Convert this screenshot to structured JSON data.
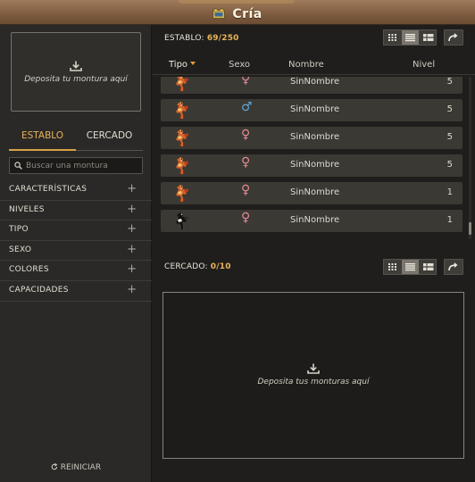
{
  "window": {
    "title": "Cría"
  },
  "left": {
    "dropzone_text": "Deposita tu montura aquí",
    "tabs": [
      "ESTABLO",
      "CERCADO"
    ],
    "search_placeholder": "Buscar una montura",
    "filters": [
      "CARACTERÍSTICAS",
      "NIVELES",
      "TIPO",
      "SEXO",
      "COLORES",
      "CAPACIDADES"
    ],
    "reset_label": "REINICIAR"
  },
  "stable": {
    "label": "ESTABLO:",
    "count": "69/250",
    "columns": [
      "Tipo",
      "Sexo",
      "Nombre",
      "Nivel"
    ],
    "rows": [
      {
        "type": "dragopavo-rojo",
        "sex": "female",
        "name": "SinNombre",
        "level": "5"
      },
      {
        "type": "dragopavo-rojo",
        "sex": "male",
        "name": "SinNombre",
        "level": "5"
      },
      {
        "type": "dragopavo-rojo",
        "sex": "female",
        "name": "SinNombre",
        "level": "5"
      },
      {
        "type": "dragopavo-rojo",
        "sex": "female",
        "name": "SinNombre",
        "level": "5"
      },
      {
        "type": "dragopavo-rojo",
        "sex": "female",
        "name": "SinNombre",
        "level": "1"
      },
      {
        "type": "dragopavo-negro",
        "sex": "female",
        "name": "SinNombre",
        "level": "1"
      }
    ]
  },
  "paddock": {
    "label": "CERCADO:",
    "count": "0/10",
    "dropzone_text": "Deposita tus monturas aquí"
  },
  "colors": {
    "accent": "#e8b45c",
    "female": "#e38a94",
    "male": "#5ea7d8",
    "panel": "#2a2927",
    "row": "#3b3934"
  },
  "icons": [
    "crown-icon",
    "download-icon",
    "search-icon",
    "plus-icon",
    "grid-view-icon",
    "list-view-icon",
    "table-view-icon",
    "share-icon",
    "reset-icon",
    "sort-desc-icon"
  ]
}
